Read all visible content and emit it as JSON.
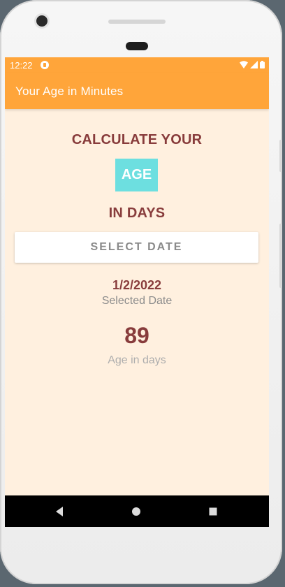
{
  "status_bar": {
    "time": "12:22",
    "icons": [
      "app-notification-icon",
      "wifi-icon",
      "signal-icon",
      "battery-icon"
    ]
  },
  "app_bar": {
    "title": "Your Age in Minutes"
  },
  "main": {
    "heading_top": "CALCULATE YOUR",
    "age_badge": "AGE",
    "heading_bottom": "IN DAYS",
    "select_date_button": "SELECT DATE",
    "selected_date_value": "1/2/2022",
    "selected_date_label": "Selected Date",
    "age_value": "89",
    "age_label": "Age in days"
  },
  "nav_bar": {
    "buttons": [
      "back-icon",
      "home-icon",
      "recents-icon"
    ]
  },
  "colors": {
    "accent": "#ffa53a",
    "background": "#fff0df",
    "heading": "#883c3c",
    "badge": "#6ddfe0"
  }
}
